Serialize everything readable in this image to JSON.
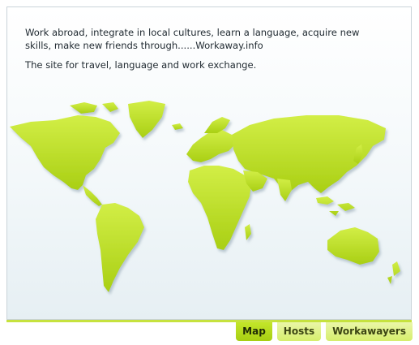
{
  "intro": {
    "text": "Work abroad, integrate in local cultures, learn a language, acquire new skills, make new friends through......Workaway.info",
    "tagline": "The site for travel, language and work exchange."
  },
  "map": {
    "land_color": "#b9df22",
    "shadow_color": "#9bb2bf"
  },
  "tabs": [
    {
      "label": "Map",
      "active": true
    },
    {
      "label": "Hosts",
      "active": false
    },
    {
      "label": "Workawayers",
      "active": false
    }
  ]
}
